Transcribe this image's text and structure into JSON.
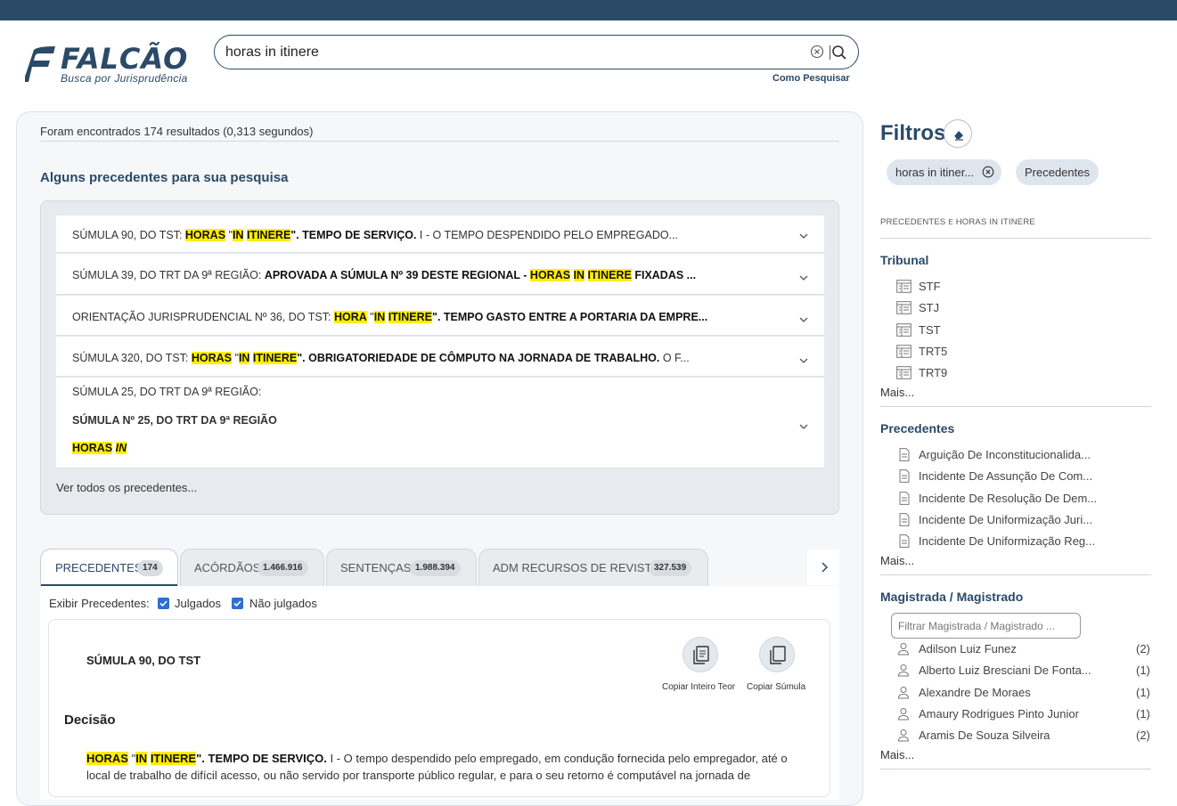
{
  "header": {
    "brand": "FALCÃO",
    "tagline": "Busca por Jurisprudência",
    "search_value": "horas in itinere",
    "how_to_search": "Como Pesquisar"
  },
  "results": {
    "summary": "Foram encontrados 174 resultados (0,313 segundos)",
    "precedents_title": "Alguns precedentes para sua pesquisa",
    "items": [
      {
        "prefix": "SÚMULA 90, DO TST: ",
        "hl1": "HORAS",
        "q1": " \"",
        "hl2": "IN",
        "sp": " ",
        "hl3": "ITINERE",
        "q2": "\". ",
        "bold": "TEMPO DE SERVIÇO.",
        "rest": " I - O TEMPO DESPENDIDO PELO EMPREGADO..."
      },
      {
        "prefix": "SÚMULA 39, DO TRT DA 9ª REGIÃO: ",
        "bold": "APROVADA A SÚMULA Nº 39 DESTE REGIONAL - ",
        "hl1": "HORAS",
        "sp1": " ",
        "hl2": "IN",
        "sp2": " ",
        "hl3": "ITINERE",
        "rest": " FIXADAS ..."
      },
      {
        "prefix": "ORIENTAÇÃO JURISPRUDENCIAL Nº 36, DO TST: ",
        "hl1": "HORA",
        "q1": " \"",
        "hl2": "IN",
        "sp": " ",
        "hl3": "ITINERE",
        "q2": "\". ",
        "bold": "TEMPO GASTO ENTRE A PORTARIA DA EMPRE..."
      },
      {
        "prefix": "SÚMULA 320, DO TST: ",
        "hl1": "HORAS",
        "q1": " \"",
        "hl2": "IN",
        "sp": " ",
        "hl3": "ITINERE",
        "q2": "\". ",
        "bold": "OBRIGATORIEDADE DE CÔMPUTO NA JORNADA DE TRABALHO.",
        "rest": " O F..."
      },
      {
        "prefix": "SÚMULA 25, DO TRT DA 9ª REGIÃO:",
        "line2": "SÚMULA Nº 25, DO TRT DA 9ª REGIÃO",
        "hl1": "HORAS",
        "hl2": "IN"
      }
    ],
    "see_all": "Ver todos os precedentes..."
  },
  "tabs": [
    {
      "label": "PRECEDENTES",
      "count": "174"
    },
    {
      "label": "ACÓRDÃOS",
      "count": "1.466.916"
    },
    {
      "label": "SENTENÇAS",
      "count": "1.988.394"
    },
    {
      "label": "ADM RECURSOS DE REVISTA",
      "count": "327.539"
    }
  ],
  "panel": {
    "show_label": "Exibir Precedentes:",
    "judged": "Julgados",
    "not_judged": "Não julgados",
    "card_title": "SÚMULA 90, DO TST",
    "copy_full": "Copiar Inteiro Teor",
    "copy_summary": "Copiar Súmula",
    "decision_heading": "Decisão",
    "decision": {
      "hl1": "HORAS",
      "q1": " \"",
      "hl2": "IN",
      "sp": " ",
      "hl3": "ITINERE",
      "q2": "\". ",
      "bold": "TEMPO DE SERVIÇO.",
      "rest": " I - O tempo despendido pelo empregado, em condução fornecida pelo empregador, até o local de trabalho de difícil acesso, ou não servido por transporte público regular, e para o seu retorno é computável na jornada de"
    }
  },
  "filters": {
    "title": "Filtros",
    "chips": [
      "horas in itiner...",
      "Precedentes"
    ],
    "crumb_a": "PRECEDENTES",
    "crumb_e": "E",
    "crumb_b": "HORAS IN ITINERE",
    "tribunal": {
      "heading": "Tribunal",
      "items": [
        "STF",
        "STJ",
        "TST",
        "TRT5",
        "TRT9"
      ],
      "more": "Mais..."
    },
    "precedentes": {
      "heading": "Precedentes",
      "items": [
        "Arguição De Inconstitucionalida...",
        "Incidente De Assunção De Com...",
        "Incidente De Resolução De Dem...",
        "Incidente De Uniformização Juri...",
        "Incidente De Uniformização Reg..."
      ],
      "more": "Mais..."
    },
    "magistrado": {
      "heading": "Magistrada / Magistrado",
      "placeholder": "Filtrar Magistrada / Magistrado ...",
      "items": [
        {
          "name": "Adilson Luiz Funez",
          "count": "(2)"
        },
        {
          "name": "Alberto Luiz Bresciani De Fonta...",
          "count": "(1)"
        },
        {
          "name": "Alexandre De Moraes",
          "count": "(1)"
        },
        {
          "name": "Amaury Rodrigues Pinto Junior",
          "count": "(1)"
        },
        {
          "name": "Aramis De Souza Silveira",
          "count": "(2)"
        }
      ],
      "more": "Mais..."
    }
  },
  "colors": {
    "navy": "#2a4a68",
    "highlight": "#ffee00",
    "checkbox": "#2e6fd1"
  }
}
